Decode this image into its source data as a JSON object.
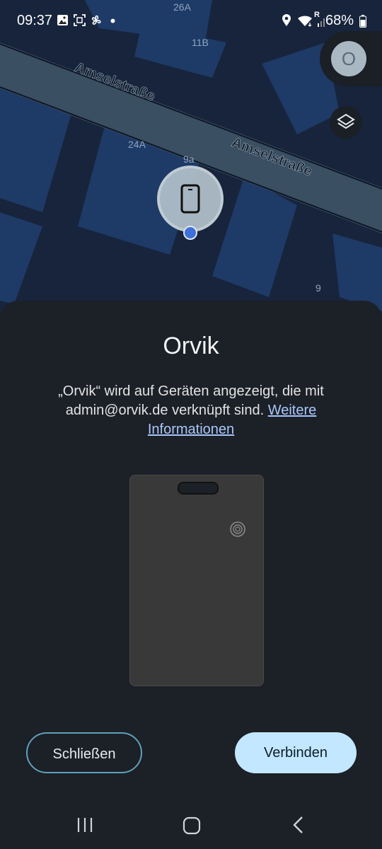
{
  "status_bar": {
    "time": "09:37",
    "battery": "68%",
    "wifi_label": "R"
  },
  "map": {
    "street_name_1": "Amselstraße",
    "street_name_2": "Amselstraße",
    "house_numbers": [
      "26A",
      "11B",
      "24A",
      "9a",
      "9"
    ],
    "colors": {
      "background": "#17243c",
      "building": "#1e3a66",
      "road": "#3a4f62"
    }
  },
  "account": {
    "avatar_letter": "O"
  },
  "sheet": {
    "title": "Orvik",
    "description_text": "„Orvik“ wird auf Geräten angezeigt, die mit admin@orvik.de verknüpft sind.",
    "link_label": "Weitere Informationen"
  },
  "buttons": {
    "close_label": "Schließen",
    "connect_label": "Verbinden"
  },
  "icons": [
    "gallery-icon",
    "screenshot-icon",
    "fan-icon",
    "location-icon",
    "wifi-icon",
    "signal-icon",
    "battery-icon",
    "layers-icon",
    "phone-icon",
    "recents-icon",
    "home-icon",
    "back-icon"
  ]
}
